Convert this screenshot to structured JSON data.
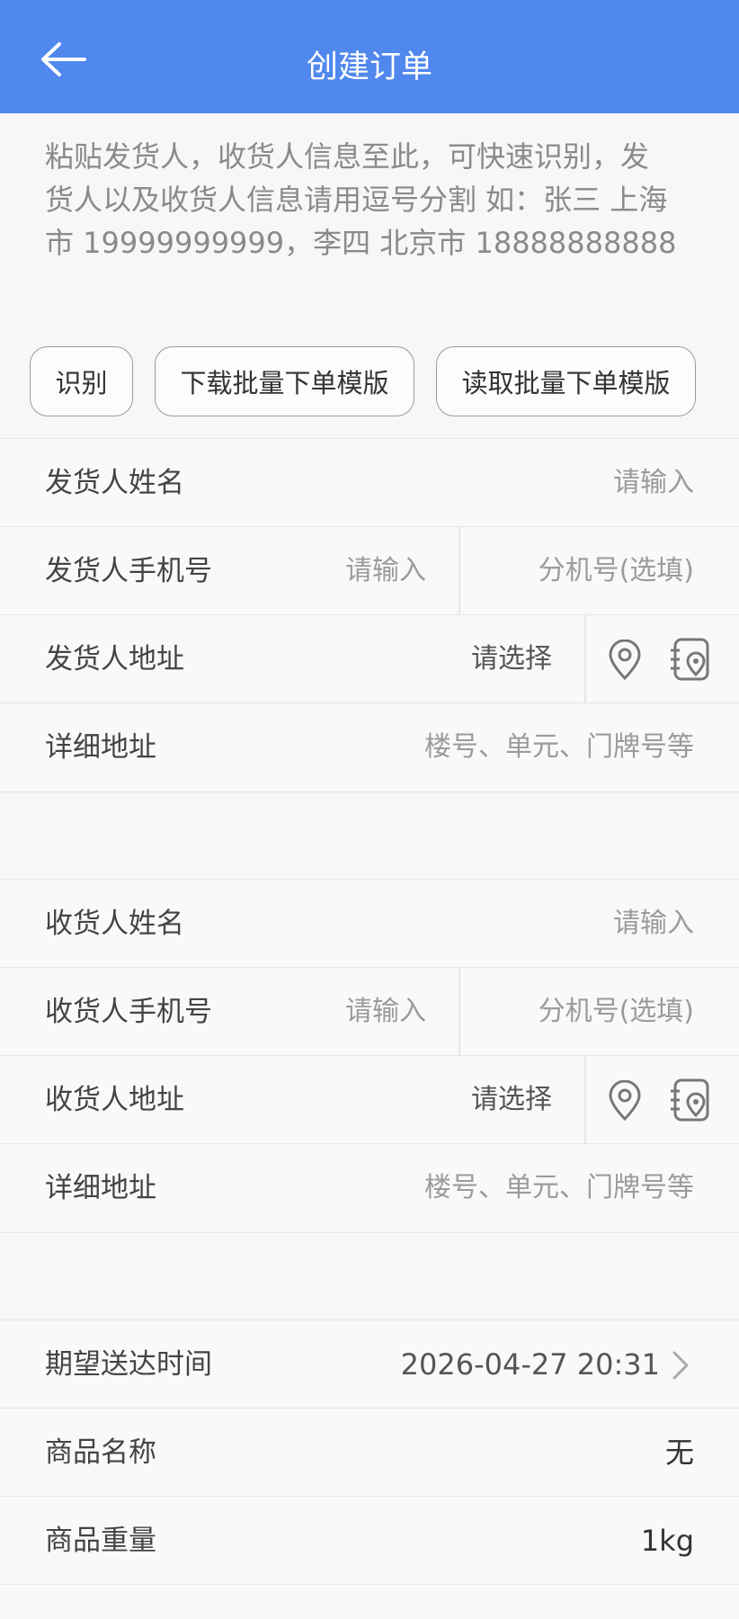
{
  "header": {
    "title": "创建订单",
    "back_icon": "arrow-left-icon"
  },
  "paste_hint": [
    "粘贴发货人，收货人信息至此，可快速识别，发",
    "货人以及收货人信息请用逗号分割 如：张三 上海",
    "市 19999999999，李四 北京市 18888888888"
  ],
  "buttons": {
    "recognize": "识别",
    "download": "下载批量下单模版",
    "read": "读取批量下单模版"
  },
  "sender": {
    "name_label": "发货人姓名",
    "name_placeholder": "请输入",
    "phone_label": "发货人手机号",
    "phone_placeholder": "请输入",
    "ext_placeholder": "分机号(选填)",
    "address_label": "发货人地址",
    "address_placeholder": "请选择",
    "detail_label": "详细地址",
    "detail_placeholder": "楼号、单元、门牌号等"
  },
  "receiver": {
    "name_label": "收货人姓名",
    "name_placeholder": "请输入",
    "phone_label": "收货人手机号",
    "phone_placeholder": "请输入",
    "ext_placeholder": "分机号(选填)",
    "address_label": "收货人地址",
    "address_placeholder": "请选择",
    "detail_label": "详细地址",
    "detail_placeholder": "楼号、单元、门牌号等"
  },
  "order": {
    "time_label": "期望送达时间",
    "time_value": "2026-04-27 20:31",
    "goods_name_label": "商品名称",
    "goods_name_value": "无",
    "weight_label": "商品重量",
    "weight_value": "1kg"
  },
  "colors": {
    "primary": "#5088ee",
    "placeholder": "#9b9b9b",
    "text": "#333333",
    "divider": "#e6e6e6"
  }
}
